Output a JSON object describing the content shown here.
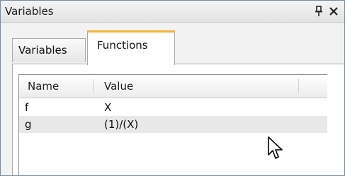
{
  "panel": {
    "title": "Variables",
    "pin_icon": "pin-icon",
    "close_icon": "close-icon"
  },
  "tabs": [
    {
      "label": "Variables",
      "active": false
    },
    {
      "label": "Functions",
      "active": true
    }
  ],
  "table": {
    "columns": [
      "Name",
      "Value"
    ],
    "rows": [
      {
        "name": "f",
        "value": "X",
        "selected": false
      },
      {
        "name": "g",
        "value": "(1)/(X)",
        "selected": true
      }
    ]
  },
  "colors": {
    "active_tab_accent": "#f2b233",
    "selected_row": "#e8e8e8"
  }
}
